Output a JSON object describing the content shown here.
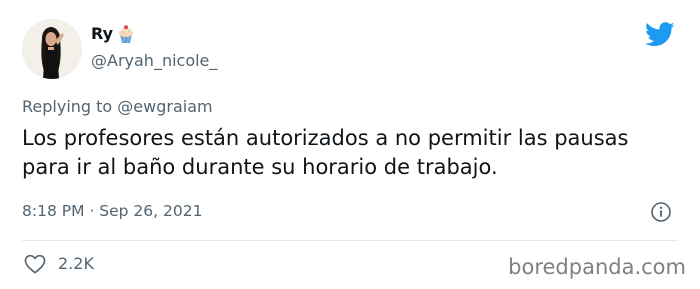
{
  "tweet": {
    "display_name": "Ry",
    "name_emoji_icon": "cupcake-icon",
    "handle": "@Aryah_nicole_",
    "replying_prefix": "Replying to",
    "replying_to": "@ewgraiam",
    "text": "Los profesores están autorizados a no permitir las pausas para ir al baño durante su horario de trabajo.",
    "time": "8:18 PM",
    "date": "Sep 26, 2021",
    "separator": "·",
    "like_count": "2.2K"
  },
  "icons": {
    "brand": "twitter-bird-icon",
    "info": "info-icon",
    "like": "heart-icon"
  },
  "watermark": "boredpanda.com",
  "colors": {
    "twitter_blue": "#1d9bf0",
    "secondary_text": "#536471",
    "primary_text": "#0f1419"
  }
}
